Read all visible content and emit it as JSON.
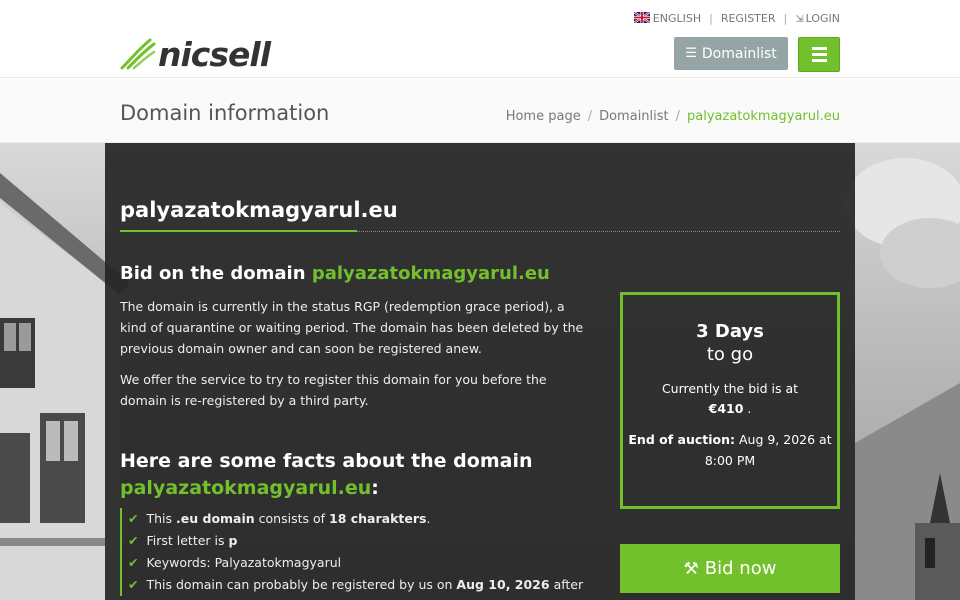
{
  "header": {
    "lang_label": "ENGLISH",
    "register_label": "REGISTER",
    "login_label": "LOGIN",
    "logo_text": "nicsell",
    "domainlist_button": "Domainlist",
    "accent_color": "#72c02c"
  },
  "breadbar": {
    "title": "Domain information",
    "crumbs": [
      "Home page",
      "Domainlist",
      "palyazatokmagyarul.eu"
    ]
  },
  "main": {
    "domain": "palyazatokmagyarul.eu",
    "bid_title_prefix": "Bid on the domain",
    "bid_title_domain": "palyazatokmagyarul.eu",
    "paragraph1": "The domain is currently in the status RGP (redemption grace period), a kind of quarantine or waiting period. The domain has been deleted by the previous domain owner and can soon be registered anew.",
    "paragraph2": "We offer the service to try to register this domain for you before the domain is re-registered by a third party.",
    "facts_title": "Here are some facts about the domain",
    "facts_domain": "palyazatokmagyarul.eu",
    "facts_colon": ":",
    "facts": [
      {
        "a": "This ",
        "b": ".eu domain",
        "c": " consists of ",
        "d": "18 charakters",
        "e": "."
      },
      {
        "a": "First letter is ",
        "b": "p"
      },
      {
        "a": "Keywords: Palyazatokmagyarul"
      },
      {
        "a": "This domain can probably be registered by us on ",
        "b": "Aug 10, 2026",
        "c": " after"
      }
    ]
  },
  "countdown": {
    "days": "3 Days",
    "to_go": "to go",
    "bid_label": "Currently the bid is at",
    "bid_value": "€410",
    "bid_suffix": " .",
    "end_label": "End of auction:",
    "end_value": " Aug 9, 2026 at 8:00 PM"
  },
  "bid_button": "Bid now"
}
